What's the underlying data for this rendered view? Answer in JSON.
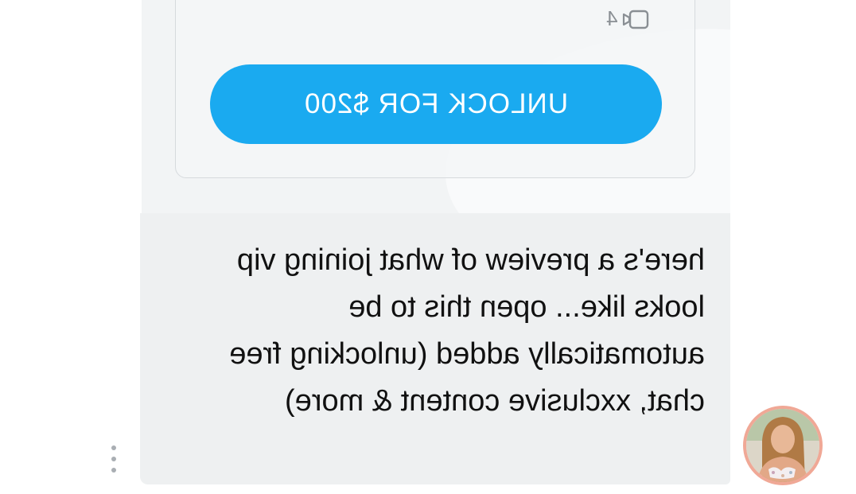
{
  "message": {
    "media_count": "4",
    "media_icon": "video-camera-icon",
    "unlock_label": "UNLOCK FOR $200",
    "text": "here's a preview of what joining vip looks like... open this to be automatically added (unlocking free chat, xxclusive content & more)",
    "more_icon": "more-vertical-icon",
    "avatar_icon": "creator-avatar"
  },
  "colors": {
    "accent": "#1aaaf0",
    "bubble": "#eef0f1",
    "avatar_ring": "#f0a896"
  }
}
